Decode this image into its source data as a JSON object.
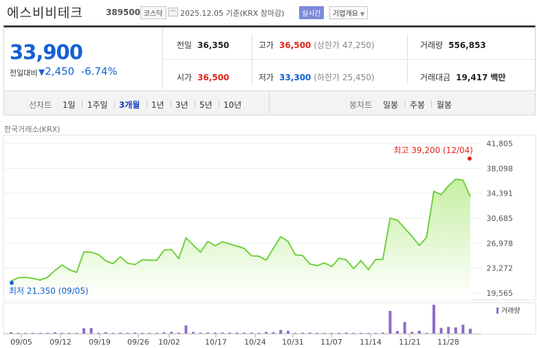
{
  "header": {
    "name": "에스비비테크",
    "code": "389500",
    "market": "코스닥",
    "date": "2025.12.05",
    "date_basis": "기준(KRX 장마감)",
    "realtime": "실시간",
    "company_info": "기업개요"
  },
  "quote": {
    "price": "33,900",
    "compare_label": "전일대비",
    "change": "2,450",
    "change_pct": "-6.74%",
    "prev_close": {
      "label": "전일",
      "value": "36,350"
    },
    "open": {
      "label": "시가",
      "value": "36,500"
    },
    "high": {
      "label": "고가",
      "value": "36,500",
      "limit_label": "(상한가 47,250)"
    },
    "low": {
      "label": "저가",
      "value": "33,300",
      "limit_label": "(하한가 25,450)"
    },
    "volume": {
      "label": "거래량",
      "value": "556,853"
    },
    "amount": {
      "label": "거래대금",
      "value": "19,417",
      "unit": "백만"
    }
  },
  "tabs": {
    "line_label": "선차트",
    "line": [
      "1일",
      "1주일",
      "3개월",
      "1년",
      "3년",
      "5년",
      "10년"
    ],
    "active_line": "3개월",
    "candle_label": "봉차트",
    "candle": [
      "일봉",
      "주봉",
      "월봉"
    ]
  },
  "chart_data": {
    "type": "area",
    "exchange_label": "한국거래소(KRX)",
    "y_ticks": [
      "41,805",
      "38,098",
      "34,391",
      "30,685",
      "26,978",
      "23,272",
      "19,565"
    ],
    "ylim": [
      19565,
      41805
    ],
    "x_ticks": [
      "09/05",
      "09/12",
      "09/19",
      "09/26",
      "10/02",
      "10/17",
      "10/24",
      "10/31",
      "11/07",
      "11/14",
      "11/21",
      "11/28"
    ],
    "price_series": [
      21350,
      21850,
      21900,
      21750,
      21500,
      21900,
      22900,
      23750,
      23050,
      22650,
      25700,
      25650,
      25300,
      24350,
      23950,
      24950,
      24000,
      23800,
      24500,
      24450,
      24450,
      25950,
      26050,
      24700,
      27800,
      26700,
      25650,
      27250,
      26600,
      27200,
      26850,
      26550,
      26200,
      25100,
      25050,
      24450,
      26250,
      27950,
      27250,
      25250,
      25150,
      23900,
      23650,
      24050,
      23500,
      24750,
      24500,
      23200,
      24400,
      23050,
      24550,
      24600,
      30700,
      30400,
      29200,
      28000,
      26650,
      27850,
      34700,
      34200,
      35500,
      36500,
      36350,
      33900
    ],
    "volume_series": [
      16,
      5,
      5,
      5,
      8,
      6,
      15,
      10,
      8,
      8,
      65,
      68,
      10,
      15,
      8,
      12,
      5,
      12,
      8,
      8,
      8,
      15,
      20,
      12,
      100,
      20,
      12,
      12,
      12,
      12,
      12,
      12,
      12,
      12,
      10,
      20,
      15,
      45,
      35,
      8,
      10,
      12,
      8,
      8,
      8,
      8,
      12,
      8,
      8,
      8,
      8,
      12,
      280,
      32,
      142,
      20,
      35,
      8,
      355,
      70,
      82,
      75,
      110,
      60
    ],
    "high_annotation": "최고 39,200 (12/04)",
    "low_annotation": "최저 21,350 (09/05)",
    "volume_legend": "거래량",
    "colors": {
      "line": "#6fd03c",
      "fill_top": "#c6f0a4",
      "fill_bottom": "#ffffff",
      "volume": "#8e6bc6",
      "high": "#e0241a",
      "low": "#1560d6"
    }
  }
}
